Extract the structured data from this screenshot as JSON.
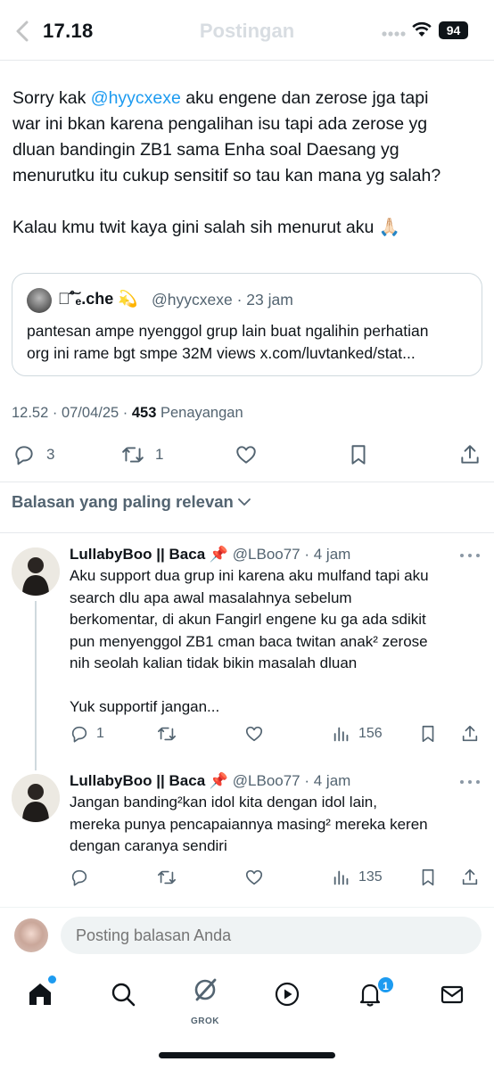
{
  "status_bar": {
    "time": "17.18",
    "battery": "94",
    "title": "Postingan"
  },
  "tweet": {
    "lines": [
      [
        "Sorry kak ",
        "@hyycxexe",
        " aku engene dan zerose jga tapi"
      ],
      "war ini bkan karena pengalihan isu tapi ada zerose yg",
      "dluan bandingin ZB1 sama Enha soal Daesang yg",
      "menurutku itu cukup sensitif so tau kan mana yg salah?",
      "Kalau kmu twit kaya gini salah sih menurut aku 🙏🏻"
    ],
    "line1": {
      "pre": "Sorry kak ",
      "mention": "@hyycxexe",
      "post": " aku engene dan zerose jga tapi"
    },
    "line2": "war ini bkan karena pengalihan isu tapi ada zerose yg",
    "line3": "dluan bandingin ZB1 sama Enha soal Daesang yg",
    "line4": "menurutku itu cukup sensitif so tau kan mana yg salah?",
    "line5": "Kalau kmu twit kaya gini salah sih menurut aku 🙏🏻",
    "quote": {
      "name": "꧂͠˚ₑ.che 💫",
      "handle_time": "@hyycxexe · 23 jam",
      "line1": "pantesan ampe nyenggol grup lain buat ngalihin perhatian",
      "line2": "org ini rame bgt smpe 32M views x.com/luvtanked/stat..."
    },
    "meta": {
      "time": "12.52 · 07/04/25 · ",
      "views": "453",
      "views_label": " Penayangan"
    },
    "actions": {
      "replies": "3",
      "retweets": "1"
    }
  },
  "sort_label": "Balasan yang paling relevan",
  "replies": [
    {
      "name": "LullabyBoo || Baca 📌",
      "handle_time": " @LBoo77 · 4 jam",
      "lines": [
        "Aku support dua grup ini karena aku mulfand tapi aku",
        "search dlu apa awal masalahnya sebelum",
        "berkomentar, di akun Fangirl engene ku ga ada sdikit",
        "pun menyenggol ZB1 cman baca twitan anak² zerose",
        "nih seolah kalian tidak bikin masalah dluan",
        "",
        "Yuk supportif jangan..."
      ],
      "reply_count": "1",
      "retweet_count": "",
      "views": "156"
    },
    {
      "name": "LullabyBoo || Baca 📌",
      "handle_time": " @LBoo77 · 4 jam",
      "lines": [
        "Jangan banding²kan idol kita dengan idol lain,",
        "mereka punya pencapaiannya masing² mereka keren",
        "dengan caranya sendiri"
      ],
      "reply_count": "",
      "retweet_count": "",
      "views": "135"
    }
  ],
  "compose": {
    "placeholder": "Posting balasan Anda"
  },
  "nav": {
    "grok_label": "GROK",
    "notification_count": "1"
  },
  "colors": {
    "accent": "#1d9bf0",
    "text": "#0f1419",
    "muted": "#536471",
    "border": "#cfd9de"
  },
  "icons": [
    "back-arrow-icon",
    "signal-icon",
    "wifi-icon",
    "reply-icon",
    "retweet-icon",
    "like-icon",
    "bookmark-icon",
    "share-icon",
    "chevron-down-icon",
    "pin-icon",
    "more-icon",
    "views-icon",
    "home-icon",
    "search-icon",
    "grok-icon",
    "video-icon",
    "bell-icon",
    "mail-icon"
  ]
}
